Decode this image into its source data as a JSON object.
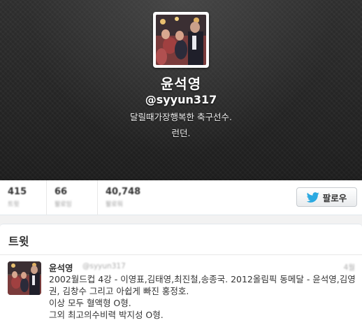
{
  "profile": {
    "display_name": "윤석영",
    "username": "@syyun317",
    "bio": "달릴때가장행복한 축구선수.",
    "location": "런던."
  },
  "stats": {
    "tweets_value": "415",
    "tweets_label": "트윗",
    "following_value": "66",
    "following_label": "팔로잉",
    "followers_value": "40,748",
    "followers_label": "팔로워"
  },
  "follow_button": {
    "label": "팔로우",
    "icon": "twitter-bird-icon"
  },
  "tweets_section": {
    "title": "트윗",
    "items": [
      {
        "name": "윤석영",
        "handle": "@syyun317",
        "time": "4월",
        "text": "2002월드컵 4강 - 이영표,김태영,최진철,송종국. 2012올림픽 동메달 - 윤석영,김영권, 김창수 그리고 아쉽게 빠진 홍정호.\n이상 모두 혈액형 O형.\n그외 최고의수비력 박지성 O형."
      }
    ]
  },
  "colors": {
    "header_bg": "#262626",
    "follow_icon": "#2ba9e1",
    "panel_bg": "#ffffff",
    "page_bg": "#f2f2f2"
  }
}
